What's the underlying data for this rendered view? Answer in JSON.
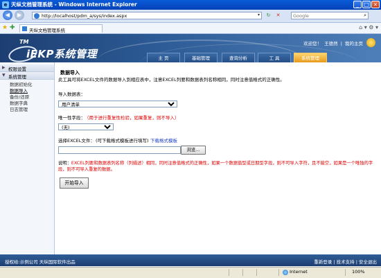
{
  "window": {
    "title": "天纵文档管理系统 - Windows Internet Explorer"
  },
  "browser": {
    "address": "http://localhost/pdm_a/sys/index.aspx",
    "search_placeholder": "Google",
    "tab_title": "天纵文档管理系统",
    "status_zone": "Internet",
    "zoom": "100%"
  },
  "header": {
    "logo_tm": "TM",
    "logo_text": "iEKP系统管理",
    "welcome": "欢迎您！",
    "username": "王德然",
    "my_home": "我的主页",
    "separator": "|",
    "nav_tabs": [
      "主 页",
      "基础管理",
      "查询分析",
      "工 具",
      "系统管理"
    ],
    "active_tab": 4
  },
  "sidebar": {
    "groups": [
      {
        "label": "权限设置",
        "arrow": "▶",
        "items": []
      },
      {
        "label": "系统管理",
        "arrow": "▼",
        "items": [
          "数据初始化",
          "数据导入",
          "备份/还原",
          "数据字典",
          "日志管理"
        ],
        "selected": 1
      }
    ]
  },
  "main": {
    "title": "数据导入",
    "description": "此工具可将EXCEL文件的数据导入到相应表中，注意EXCEL列要和数据表列名称相同，同时注意值格式的正确性。",
    "table_label": "导入数据表：",
    "table_value": "用户清单",
    "unique_label": "唯一性字段：",
    "unique_hint": "（用于进行重复性检验，如果重复，则不导入）",
    "unique_value": "(无)",
    "file_label": "选择EXCEL文件：",
    "file_hint": "(可下载格式模板进行填写)",
    "download_link": "下载格式模板",
    "browse_button": "浏览...",
    "note_label": "说明：",
    "note_text": "EXCEL列要和数据表列名称（列描述）相同，同时注意值格式的正确性，如果一个数据值型或日期型字段，则不可导入字符，且不能空，如果是一个唯独的字段，则不可导入重复的数据。",
    "import_button": "开始导入"
  },
  "footer": {
    "left": "授权给:示例公司   天纵国际软件出品",
    "right": "重新登录 | 技术支持 | 安全退出"
  },
  "colors": {
    "header_dark": "#1d3e72",
    "active_tab": "#e99a1a",
    "hint_red": "#e00000",
    "link_blue": "#1a3fc4"
  }
}
